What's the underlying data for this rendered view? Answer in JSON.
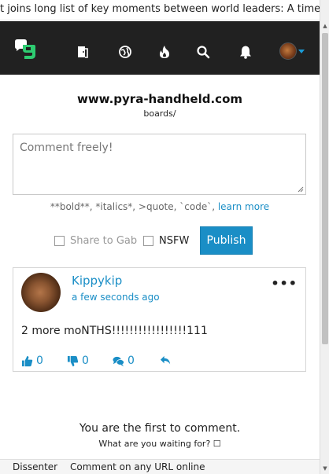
{
  "ticker": {
    "text": "t joins long list of key moments between world leaders: A timelin"
  },
  "navbar": {
    "icons": [
      "logo-icon",
      "door-icon",
      "globe-icon",
      "fire-icon",
      "search-icon",
      "bell-icon",
      "avatar",
      "caret-down-icon"
    ]
  },
  "header": {
    "title": "www.pyra-handheld.com",
    "subtitle": "boards/"
  },
  "composer": {
    "placeholder": "Comment freely!",
    "format_hint": "**bold**, *italics*, >quote, `code`,",
    "learn_more": "learn more",
    "share_label": "Share to Gab",
    "nsfw_label": "NSFW",
    "publish_label": "Publish"
  },
  "comment": {
    "author": "Kippykip",
    "time": "a few seconds ago",
    "body": "2 more moNTHS!!!!!!!!!!!!!!!!!111",
    "upvotes": "0",
    "downvotes": "0",
    "replies": "0"
  },
  "empty_state": {
    "title": "You are the first to comment.",
    "subtitle": "What are you waiting for? ☐"
  },
  "footer": {
    "brand": "Dissenter",
    "tagline": "Comment on any URL online"
  },
  "colors": {
    "accent": "#1a8ec6",
    "navbar": "#212121",
    "logo": "#2ecc71"
  }
}
